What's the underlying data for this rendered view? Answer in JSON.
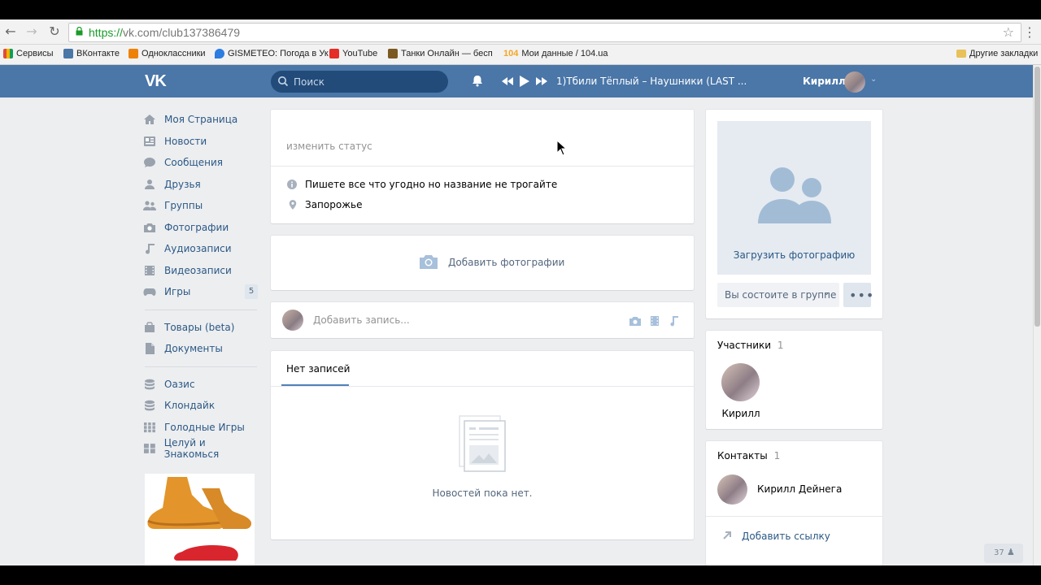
{
  "browser": {
    "url_proto": "https://",
    "url_rest": "vk.com/club137386479",
    "bookmarks": [
      {
        "label": "Сервисы",
        "color": "#e04d3a"
      },
      {
        "label": "ВКонтакте",
        "color": "#4a76a8"
      },
      {
        "label": "Одноклассники",
        "color": "#ee8208"
      },
      {
        "label": "GISMETEO: Погода в Ук",
        "color": "#2b7de1"
      },
      {
        "label": "YouTube",
        "color": "#e52d27"
      },
      {
        "label": "Танки Онлайн — бесп",
        "color": "#7a5a22"
      },
      {
        "label": "Мои данные / 104.ua",
        "color": "#f5a623"
      }
    ],
    "other_bookmarks": "Другие закладки",
    "bm104": "104"
  },
  "header": {
    "logo": "VK",
    "search_placeholder": "Поиск",
    "track": "1)Тбили Тёплый – Наушники (LAST ...",
    "user_name": "Кирилл"
  },
  "nav": {
    "items": [
      {
        "label": "Моя Страница",
        "icon": "home-icon"
      },
      {
        "label": "Новости",
        "icon": "news-icon"
      },
      {
        "label": "Сообщения",
        "icon": "messages-icon"
      },
      {
        "label": "Друзья",
        "icon": "friends-icon"
      },
      {
        "label": "Группы",
        "icon": "groups-icon"
      },
      {
        "label": "Фотографии",
        "icon": "camera-icon"
      },
      {
        "label": "Аудиозаписи",
        "icon": "music-icon"
      },
      {
        "label": "Видеозаписи",
        "icon": "video-icon"
      },
      {
        "label": "Игры",
        "icon": "gamepad-icon",
        "count": "5"
      }
    ],
    "items2": [
      {
        "label": "Товары (beta)",
        "icon": "bag-icon"
      },
      {
        "label": "Документы",
        "icon": "document-icon"
      }
    ],
    "items3": [
      {
        "label": "Оазис",
        "icon": "db-icon"
      },
      {
        "label": "Клондайк",
        "icon": "db-icon"
      },
      {
        "label": "Голодные Игры",
        "icon": "grid-icon"
      },
      {
        "label": "Целуй и Знакомься",
        "icon": "grid-icon"
      }
    ]
  },
  "main": {
    "status_placeholder": "изменить статус",
    "description": "Пишете все что угодно но название не трогайте",
    "location": "Запорожье",
    "add_photos": "Добавить фотографии",
    "post_placeholder": "Добавить запись...",
    "tab_label": "Нет записей",
    "empty_text": "Новостей пока нет."
  },
  "right": {
    "upload_photo": "Загрузить фотографию",
    "member_status": "Вы состоите в группе",
    "members_title": "Участники",
    "members_count": "1",
    "member_name": "Кирилл",
    "contacts_title": "Контакты",
    "contacts_count": "1",
    "contact_name": "Кирилл Дейнега",
    "add_link": "Добавить ссылку",
    "online_count": "37"
  },
  "colors": {
    "vk_blue": "#4a76a8",
    "link": "#2a5885",
    "bg": "#edeef0"
  }
}
